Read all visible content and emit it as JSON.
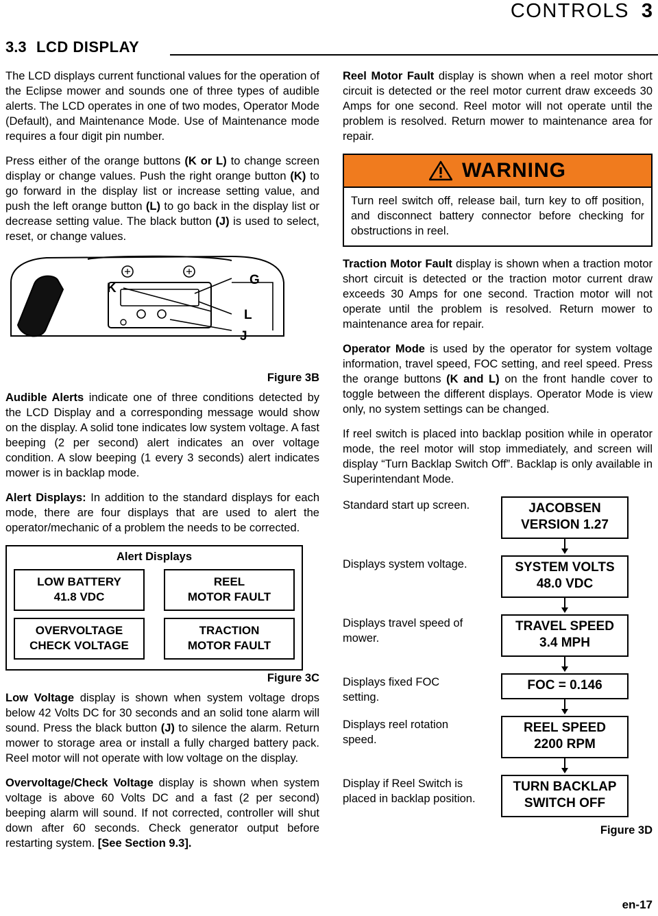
{
  "header": {
    "title": "CONTROLS",
    "page_number": "3"
  },
  "section": {
    "number": "3.3",
    "title": "LCD DISPLAY"
  },
  "left": {
    "p1": "The LCD displays current functional values for the operation of the Eclipse mower and sounds one of three types of audible alerts. The LCD operates in one of two modes, Operator Mode (Default), and Maintenance Mode. Use of Maintenance mode requires a four digit pin number.",
    "p2_a": "Press either of the orange buttons ",
    "p2_b": "(K or L)",
    "p2_c": " to change screen display or change values. Push the right orange button ",
    "p2_d": "(K)",
    "p2_e": " to go forward in the display list or increase setting value, and push the left orange button ",
    "p2_f": "(L)",
    "p2_g": " to go back in the display list or decrease setting value. The black button ",
    "p2_h": "(J)",
    "p2_i": " is used to select, reset, or change values.",
    "figure_3b_caption": "Figure 3B",
    "figure_3b_labels": {
      "k": "K",
      "g": "G",
      "l": "L",
      "j": "J"
    },
    "p3_b": "Audible Alerts",
    "p3_rest": " indicate one of three conditions detected by the LCD Display and a corresponding message would show on the display. A solid tone indicates low system voltage. A fast beeping (2 per second) alert indicates an over voltage condition. A slow beeping (1 every 3 seconds) alert indicates mower is in backlap mode.",
    "p4_b": "Alert Displays:",
    "p4_rest": " In addition to the standard displays for each mode, there are four displays that are used to alert the operator/mechanic of a problem the needs to be corrected.",
    "alert_box": {
      "title": "Alert Displays",
      "cells": [
        "LOW BATTERY\n41.8 VDC",
        "REEL\nMOTOR FAULT",
        "OVERVOLTAGE\nCHECK VOLTAGE",
        "TRACTION\nMOTOR FAULT"
      ]
    },
    "figure_3c_caption": "Figure 3C",
    "p5_b": "Low Voltage",
    "p5_mid": " display is shown when system voltage drops below 42 Volts DC for 30 seconds and an solid tone alarm will sound. Press the black button ",
    "p5_j": "(J)",
    "p5_end": " to silence the alarm. Return mower to storage area or install a fully charged battery pack. Reel motor will not operate with low voltage on the display.",
    "p6_b": "Overvoltage/Check Voltage",
    "p6_rest": " display is shown when system voltage is above 60 Volts DC and a fast (2 per second) beeping alarm will sound. If not corrected, controller will shut down after 60 seconds. Check generator output before restarting system. ",
    "p6_bold_end": "[See Section 9.3]."
  },
  "right": {
    "p1_b": "Reel Motor Fault",
    "p1_rest": " display is shown when a reel motor short circuit is detected or the reel motor current draw exceeds 30 Amps for one second. Reel motor will not operate until the problem is resolved. Return mower to maintenance area for repair.",
    "warning": {
      "word": "WARNING",
      "text": "Turn reel switch off, release bail, turn key to off position, and disconnect battery connector before checking for obstructions in reel.",
      "header_color": "#F07B1E"
    },
    "p2_b": "Traction Motor Fault",
    "p2_rest": " display is shown when a traction motor short circuit is detected or the traction motor current draw exceeds 30 Amps for one second. Traction motor will not operate until the problem is resolved. Return mower to maintenance area for repair.",
    "p3_b": "Operator Mode",
    "p3_mid": " is used by the operator for system voltage information, travel speed, FOC setting, and reel speed. Press the orange buttons ",
    "p3_kl": "(K and L)",
    "p3_end": " on the front handle cover to toggle between the different displays. Operator Mode is view only, no system settings can be changed.",
    "p4": "If reel switch is placed into backlap position while in operator mode, the reel motor will stop immediately, and screen will display “Turn Backlap Switch Off”. Backlap is only available in Superintendant Mode.",
    "figure_3d": {
      "rows": [
        {
          "desc": "Standard start up screen.",
          "lcd": "JACOBSEN\nVERSION 1.27"
        },
        {
          "desc": "Displays system voltage.",
          "lcd": "SYSTEM VOLTS\n48.0 VDC"
        },
        {
          "desc": "Displays travel speed of mower.",
          "lcd": "TRAVEL SPEED\n3.4 MPH"
        },
        {
          "desc": "Displays fixed FOC setting.",
          "lcd": "FOC = 0.146"
        },
        {
          "desc": "Displays reel rotation speed.",
          "lcd": "REEL SPEED\n2200 RPM"
        },
        {
          "desc": "Display if Reel Switch is placed in backlap position.",
          "lcd": "TURN BACKLAP\nSWITCH OFF"
        }
      ],
      "caption": "Figure 3D"
    }
  },
  "footer": "en-17"
}
